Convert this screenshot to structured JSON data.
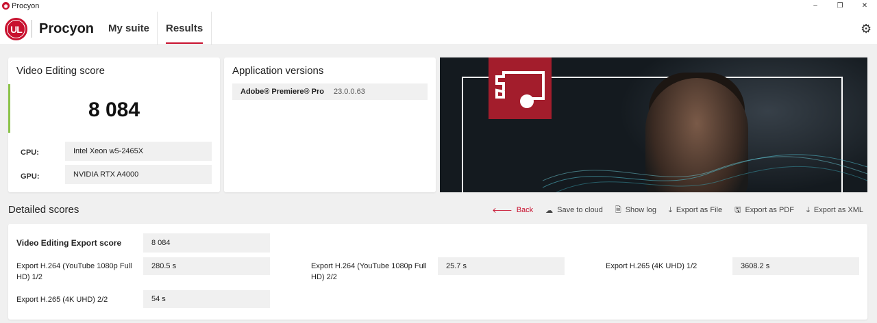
{
  "window": {
    "title": "Procyon",
    "controls": [
      "–",
      "❐",
      "✕"
    ]
  },
  "header": {
    "logo_text": "UL",
    "brand": "Procyon",
    "tabs": [
      {
        "label": "My suite",
        "active": false
      },
      {
        "label": "Results",
        "active": true
      }
    ],
    "settings_icon": "gear-icon"
  },
  "score_card": {
    "title": "Video Editing score",
    "score": "8 084",
    "cpu_label": "CPU:",
    "cpu_value": "Intel Xeon w5-2465X",
    "gpu_label": "GPU:",
    "gpu_value": "NVIDIA RTX A4000",
    "accent_color": "#8bc34a"
  },
  "app_versions": {
    "title": "Application versions",
    "apps": [
      {
        "name": "Adobe® Premiere® Pro",
        "version": "23.0.0.63"
      }
    ]
  },
  "detailed": {
    "title": "Detailed scores",
    "actions": [
      {
        "label": "Back",
        "icon": "arrow-left-icon"
      },
      {
        "label": "Save to cloud",
        "icon": "cloud-upload-icon"
      },
      {
        "label": "Show log",
        "icon": "document-icon"
      },
      {
        "label": "Export as File",
        "icon": "download-icon"
      },
      {
        "label": "Export as PDF",
        "icon": "save-icon"
      },
      {
        "label": "Export as XML",
        "icon": "download-icon"
      }
    ],
    "main_score": {
      "label": "Video Editing Export score",
      "value": "8 084"
    },
    "subscores": [
      {
        "label": "Export H.264 (YouTube 1080p Full HD) 1/2",
        "value": "280.5 s"
      },
      {
        "label": "Export H.264 (YouTube 1080p Full HD) 2/2",
        "value": "25.7 s"
      },
      {
        "label": "Export H.265 (4K UHD) 1/2",
        "value": "3608.2 s"
      },
      {
        "label": "Export H.265 (4K UHD) 2/2",
        "value": "54 s"
      }
    ]
  },
  "colors": {
    "brand_red": "#c8102e",
    "banner_red": "#a31d2c"
  }
}
